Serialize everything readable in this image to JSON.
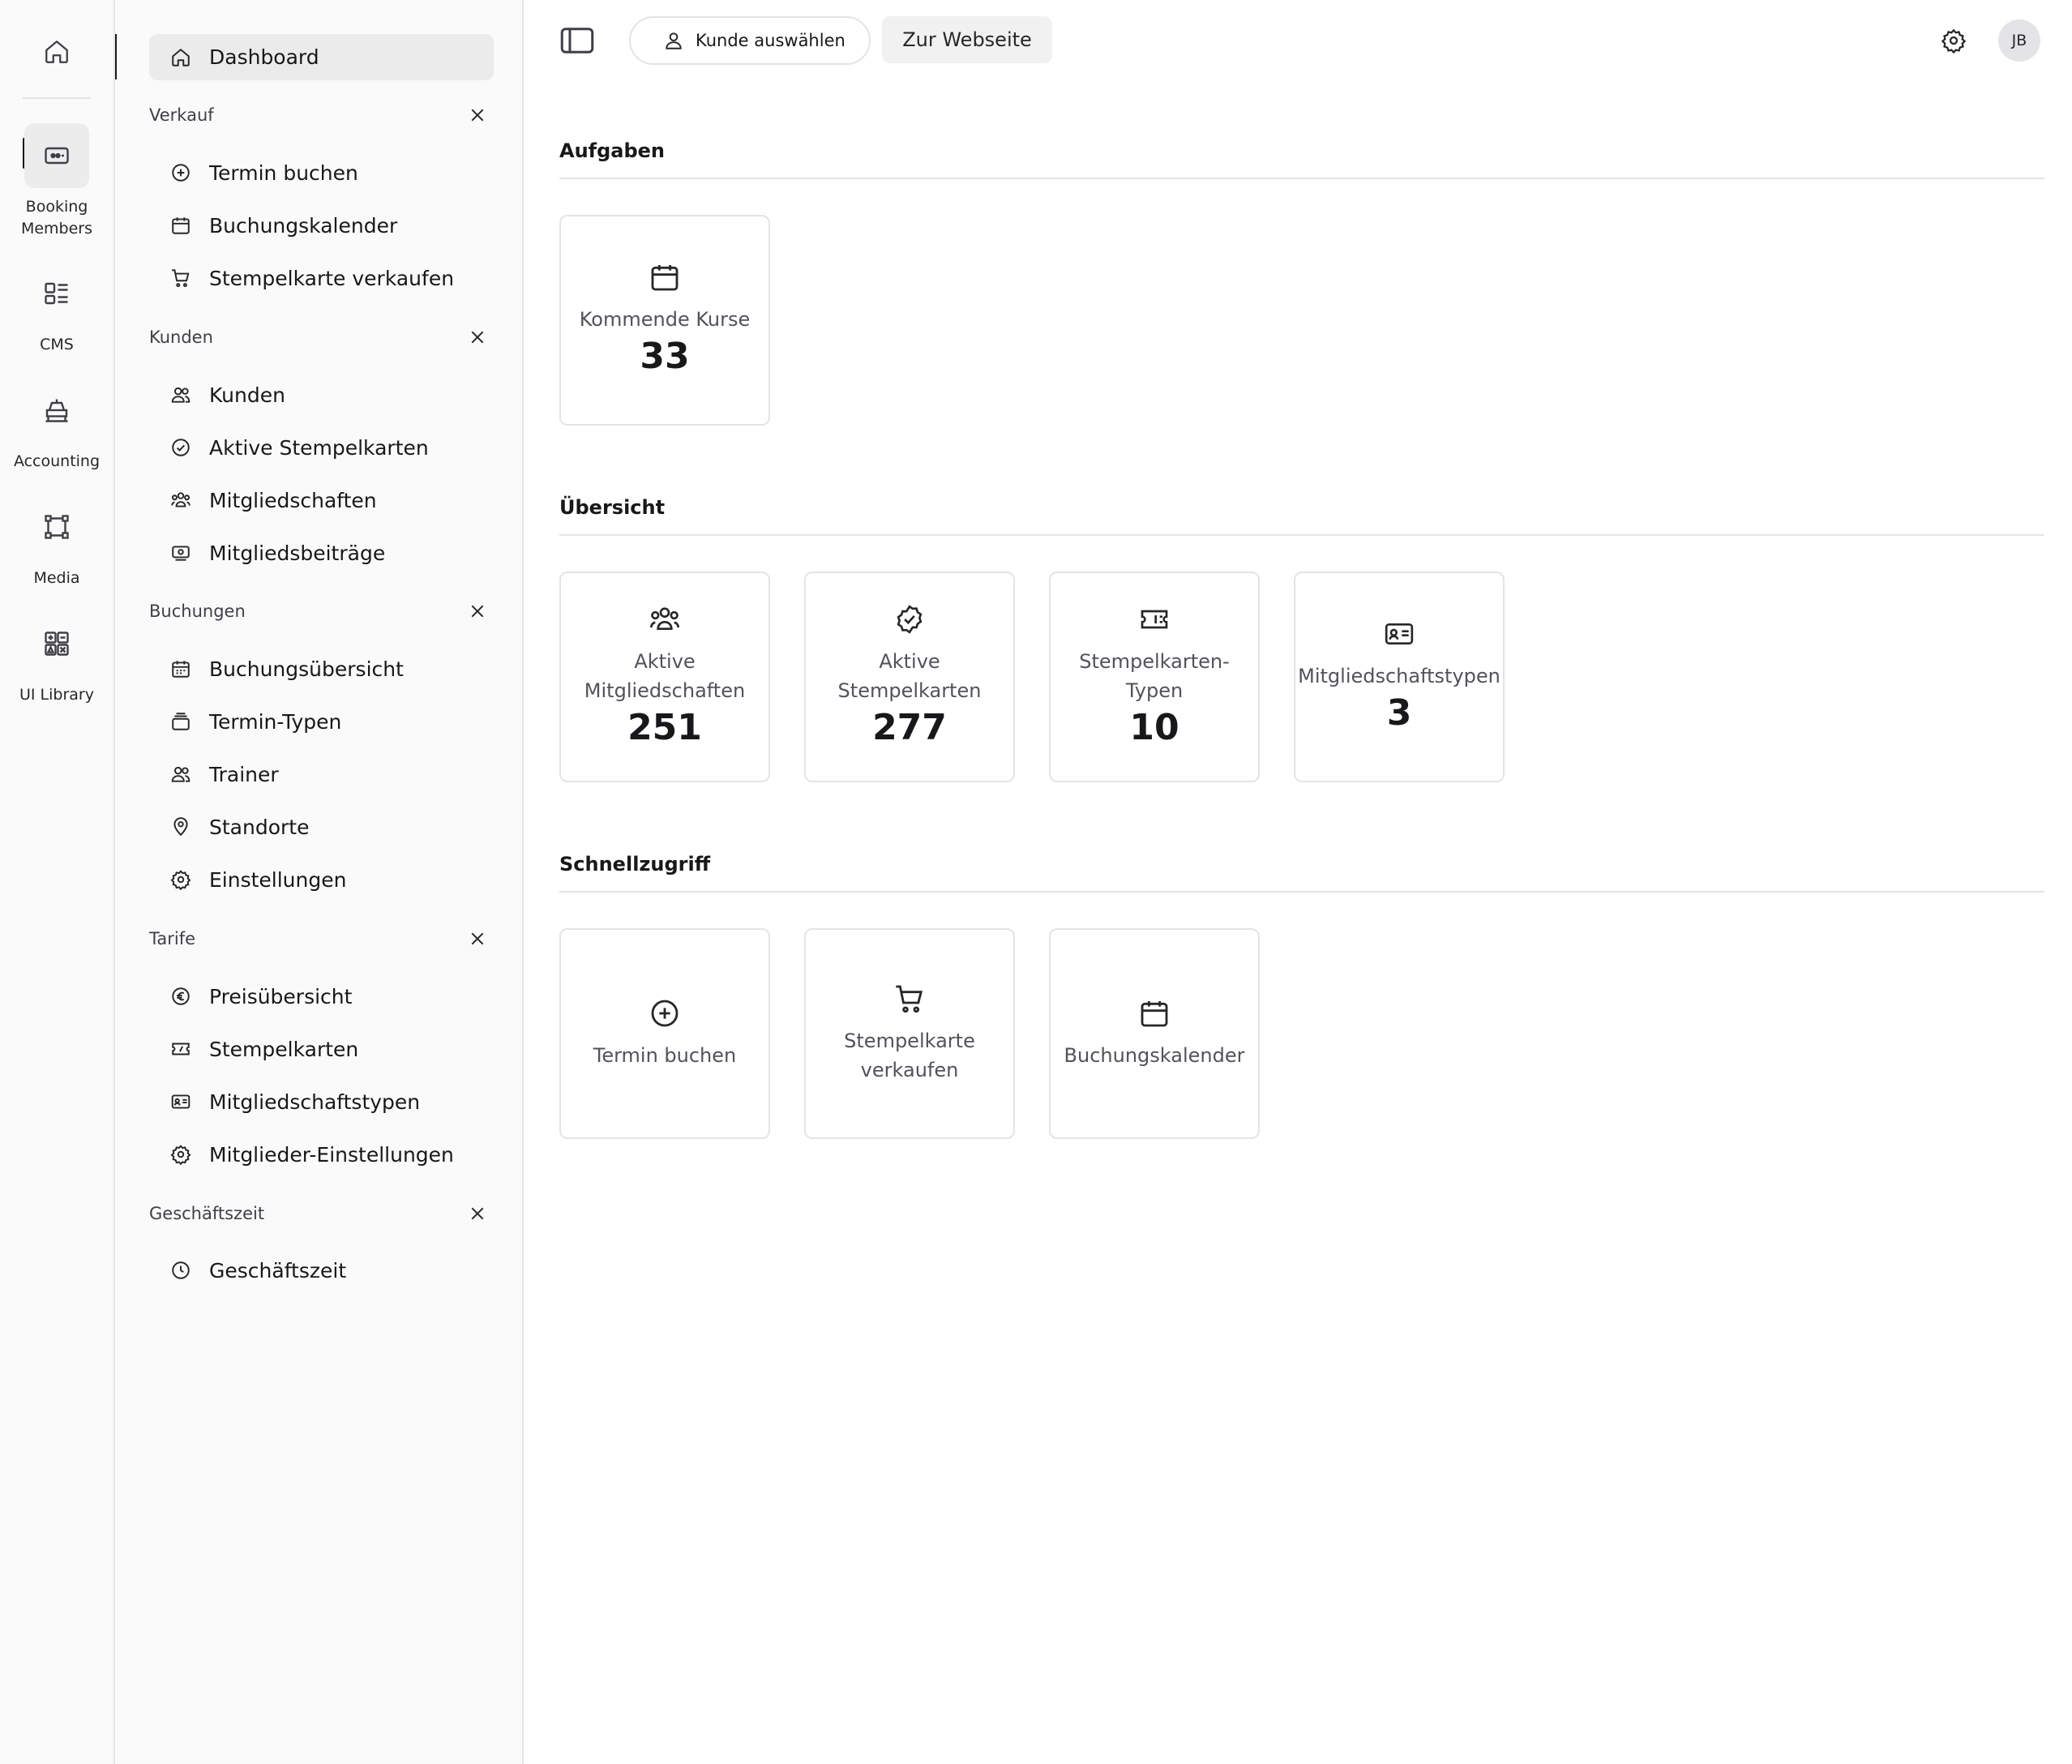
{
  "rail": {
    "items": [
      {
        "label": "Booking Members",
        "icon": "booking-members-icon"
      },
      {
        "label": "CMS",
        "icon": "cms-icon"
      },
      {
        "label": "Accounting",
        "icon": "accounting-icon"
      },
      {
        "label": "Media",
        "icon": "media-icon"
      },
      {
        "label": "UI Library",
        "icon": "ui-library-icon"
      }
    ]
  },
  "sidebar": {
    "dashboard": "Dashboard",
    "sections": [
      {
        "title": "Verkauf",
        "items": [
          "Termin buchen",
          "Buchungskalender",
          "Stempelkarte verkaufen"
        ]
      },
      {
        "title": "Kunden",
        "items": [
          "Kunden",
          "Aktive Stempelkarten",
          "Mitgliedschaften",
          "Mitgliedsbeiträge"
        ]
      },
      {
        "title": "Buchungen",
        "items": [
          "Buchungsübersicht",
          "Termin-Typen",
          "Trainer",
          "Standorte",
          "Einstellungen"
        ]
      },
      {
        "title": "Tarife",
        "items": [
          "Preisübersicht",
          "Stempelkarten",
          "Mitgliedschaftstypen",
          "Mitglieder-Einstellungen"
        ]
      },
      {
        "title": "Geschäftszeit",
        "items": [
          "Geschäftszeit"
        ]
      }
    ]
  },
  "header": {
    "kunde_button": "Kunde auswählen",
    "website_button": "Zur Webseite",
    "avatar_initials": "JB"
  },
  "main": {
    "aufgaben": {
      "title": "Aufgaben",
      "cards": [
        {
          "label": "Kommende Kurse",
          "value": "33"
        }
      ]
    },
    "uebersicht": {
      "title": "Übersicht",
      "cards": [
        {
          "label": "Aktive Mitgliedschaften",
          "value": "251"
        },
        {
          "label": "Aktive Stempelkarten",
          "value": "277"
        },
        {
          "label": "Stempelkarten-Typen",
          "value": "10"
        },
        {
          "label": "Mitgliedschaftstypen",
          "value": "3"
        }
      ]
    },
    "schnellzugriff": {
      "title": "Schnellzugriff",
      "cards": [
        {
          "label": "Termin buchen"
        },
        {
          "label": "Stempelkarte verkaufen"
        },
        {
          "label": "Buchungskalender"
        }
      ]
    }
  }
}
